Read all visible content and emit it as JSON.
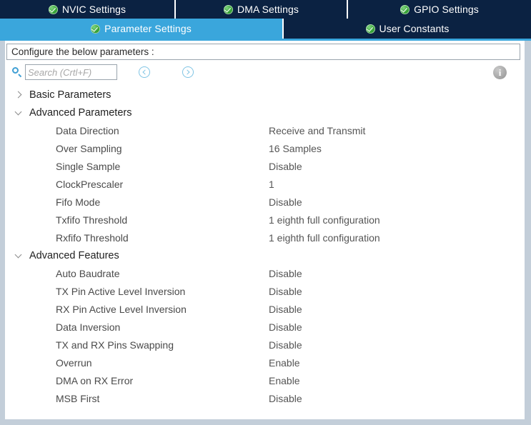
{
  "tabs": {
    "row1": [
      {
        "label": "NVIC Settings",
        "icon": "green-check-icon",
        "active": false
      },
      {
        "label": "DMA Settings",
        "icon": "green-check-icon",
        "active": false
      },
      {
        "label": "GPIO Settings",
        "icon": "green-check-icon",
        "active": false
      }
    ],
    "row2": [
      {
        "label": "Parameter Settings",
        "icon": "green-check-icon",
        "active": true
      },
      {
        "label": "User Constants",
        "icon": "green-check-icon",
        "active": false
      }
    ]
  },
  "banner": {
    "text": "Configure the below parameters :"
  },
  "toolbar": {
    "search_icon": "search-icon",
    "search_value": "",
    "search_placeholder": "Search (Crtl+F)",
    "prev_icon": "chevron-left-circle-icon",
    "next_icon": "chevron-right-circle-icon",
    "info_icon": "info-icon",
    "info_glyph": "i"
  },
  "tree": {
    "groups": [
      {
        "label": "Basic Parameters",
        "expanded": false,
        "rows": []
      },
      {
        "label": "Advanced Parameters",
        "expanded": true,
        "rows": [
          {
            "name": "Data Direction",
            "value": "Receive and Transmit"
          },
          {
            "name": "Over Sampling",
            "value": "16 Samples"
          },
          {
            "name": "Single Sample",
            "value": "Disable"
          },
          {
            "name": "ClockPrescaler",
            "value": "1"
          },
          {
            "name": "Fifo Mode",
            "value": "Disable"
          },
          {
            "name": "Txfifo Threshold",
            "value": "1 eighth full configuration"
          },
          {
            "name": "Rxfifo Threshold",
            "value": "1 eighth full configuration"
          }
        ]
      },
      {
        "label": "Advanced Features",
        "expanded": true,
        "rows": [
          {
            "name": "Auto Baudrate",
            "value": "Disable"
          },
          {
            "name": "TX Pin Active Level Inversion",
            "value": "Disable"
          },
          {
            "name": "RX Pin Active Level Inversion",
            "value": "Disable"
          },
          {
            "name": "Data Inversion",
            "value": "Disable"
          },
          {
            "name": "TX and RX Pins Swapping",
            "value": "Disable"
          },
          {
            "name": "Overrun",
            "value": "Enable"
          },
          {
            "name": "DMA on RX Error",
            "value": "Enable"
          },
          {
            "name": "MSB First",
            "value": "Disable"
          }
        ]
      }
    ]
  },
  "colors": {
    "tab_inactive_bg": "#0b2242",
    "tab_active_bg": "#3aa6dc",
    "accent": "#3aa6dc",
    "frame_border": "#c3ced9",
    "check_green": "#36a436",
    "text_primary": "#3d3d3d",
    "text_value": "#555555"
  }
}
